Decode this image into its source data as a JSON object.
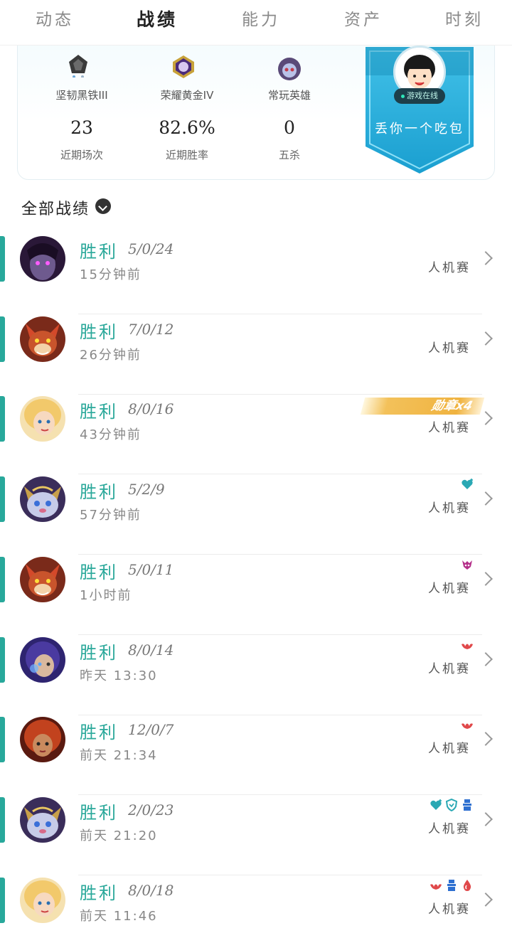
{
  "tabs": [
    {
      "label": "动态"
    },
    {
      "label": "战绩"
    },
    {
      "label": "能力"
    },
    {
      "label": "资产"
    },
    {
      "label": "时刻"
    }
  ],
  "profile": {
    "rank_solo": "坚韧黑铁III",
    "rank_flex": "荣耀黄金IV",
    "common_hero_label": "常玩英雄",
    "stats": [
      {
        "value": "23",
        "label": "近期场次"
      },
      {
        "value": "82.6%",
        "label": "近期胜率"
      },
      {
        "value": "0",
        "label": "五杀"
      }
    ],
    "online_status": "游戏在线",
    "banner_text": "丢你一个吃包",
    "colors": {
      "banner": "#1ba9d6",
      "accent": "#28a89b"
    }
  },
  "section": {
    "title": "全部战绩"
  },
  "matches": [
    {
      "result": "胜利",
      "kda": "5/0/24",
      "time": "15分钟前",
      "mode": "人机赛",
      "hero": "purple-hero",
      "badges": []
    },
    {
      "result": "胜利",
      "kda": "7/0/12",
      "time": "26分钟前",
      "mode": "人机赛",
      "hero": "fox-hero",
      "badges": []
    },
    {
      "result": "胜利",
      "kda": "8/0/16",
      "time": "43分钟前",
      "mode": "人机赛",
      "hero": "blonde-hero",
      "medal": "勋章x4",
      "badges": []
    },
    {
      "result": "胜利",
      "kda": "5/2/9",
      "time": "57分钟前",
      "mode": "人机赛",
      "hero": "yordle-hero",
      "badges": [
        "heart-plus-icon"
      ]
    },
    {
      "result": "胜利",
      "kda": "5/0/11",
      "time": "1小时前",
      "mode": "人机赛",
      "hero": "fox-hero",
      "badges": [
        "demon-icon"
      ]
    },
    {
      "result": "胜利",
      "kda": "8/0/14",
      "time": "昨天 13:30",
      "mode": "人机赛",
      "hero": "mage-hero",
      "badges": [
        "crown-icon"
      ]
    },
    {
      "result": "胜利",
      "kda": "12/0/7",
      "time": "前天 21:34",
      "mode": "人机赛",
      "hero": "redhair-hero",
      "badges": [
        "crown-icon"
      ]
    },
    {
      "result": "胜利",
      "kda": "2/0/23",
      "time": "前天 21:20",
      "mode": "人机赛",
      "hero": "yordle-hero",
      "badges": [
        "heart-plus-icon",
        "shield-icon",
        "tower-icon"
      ]
    },
    {
      "result": "胜利",
      "kda": "8/0/18",
      "time": "前天 11:46",
      "mode": "人机赛",
      "hero": "blonde-hero",
      "badges": [
        "crown-icon",
        "tower-icon",
        "drop-icon"
      ]
    }
  ]
}
